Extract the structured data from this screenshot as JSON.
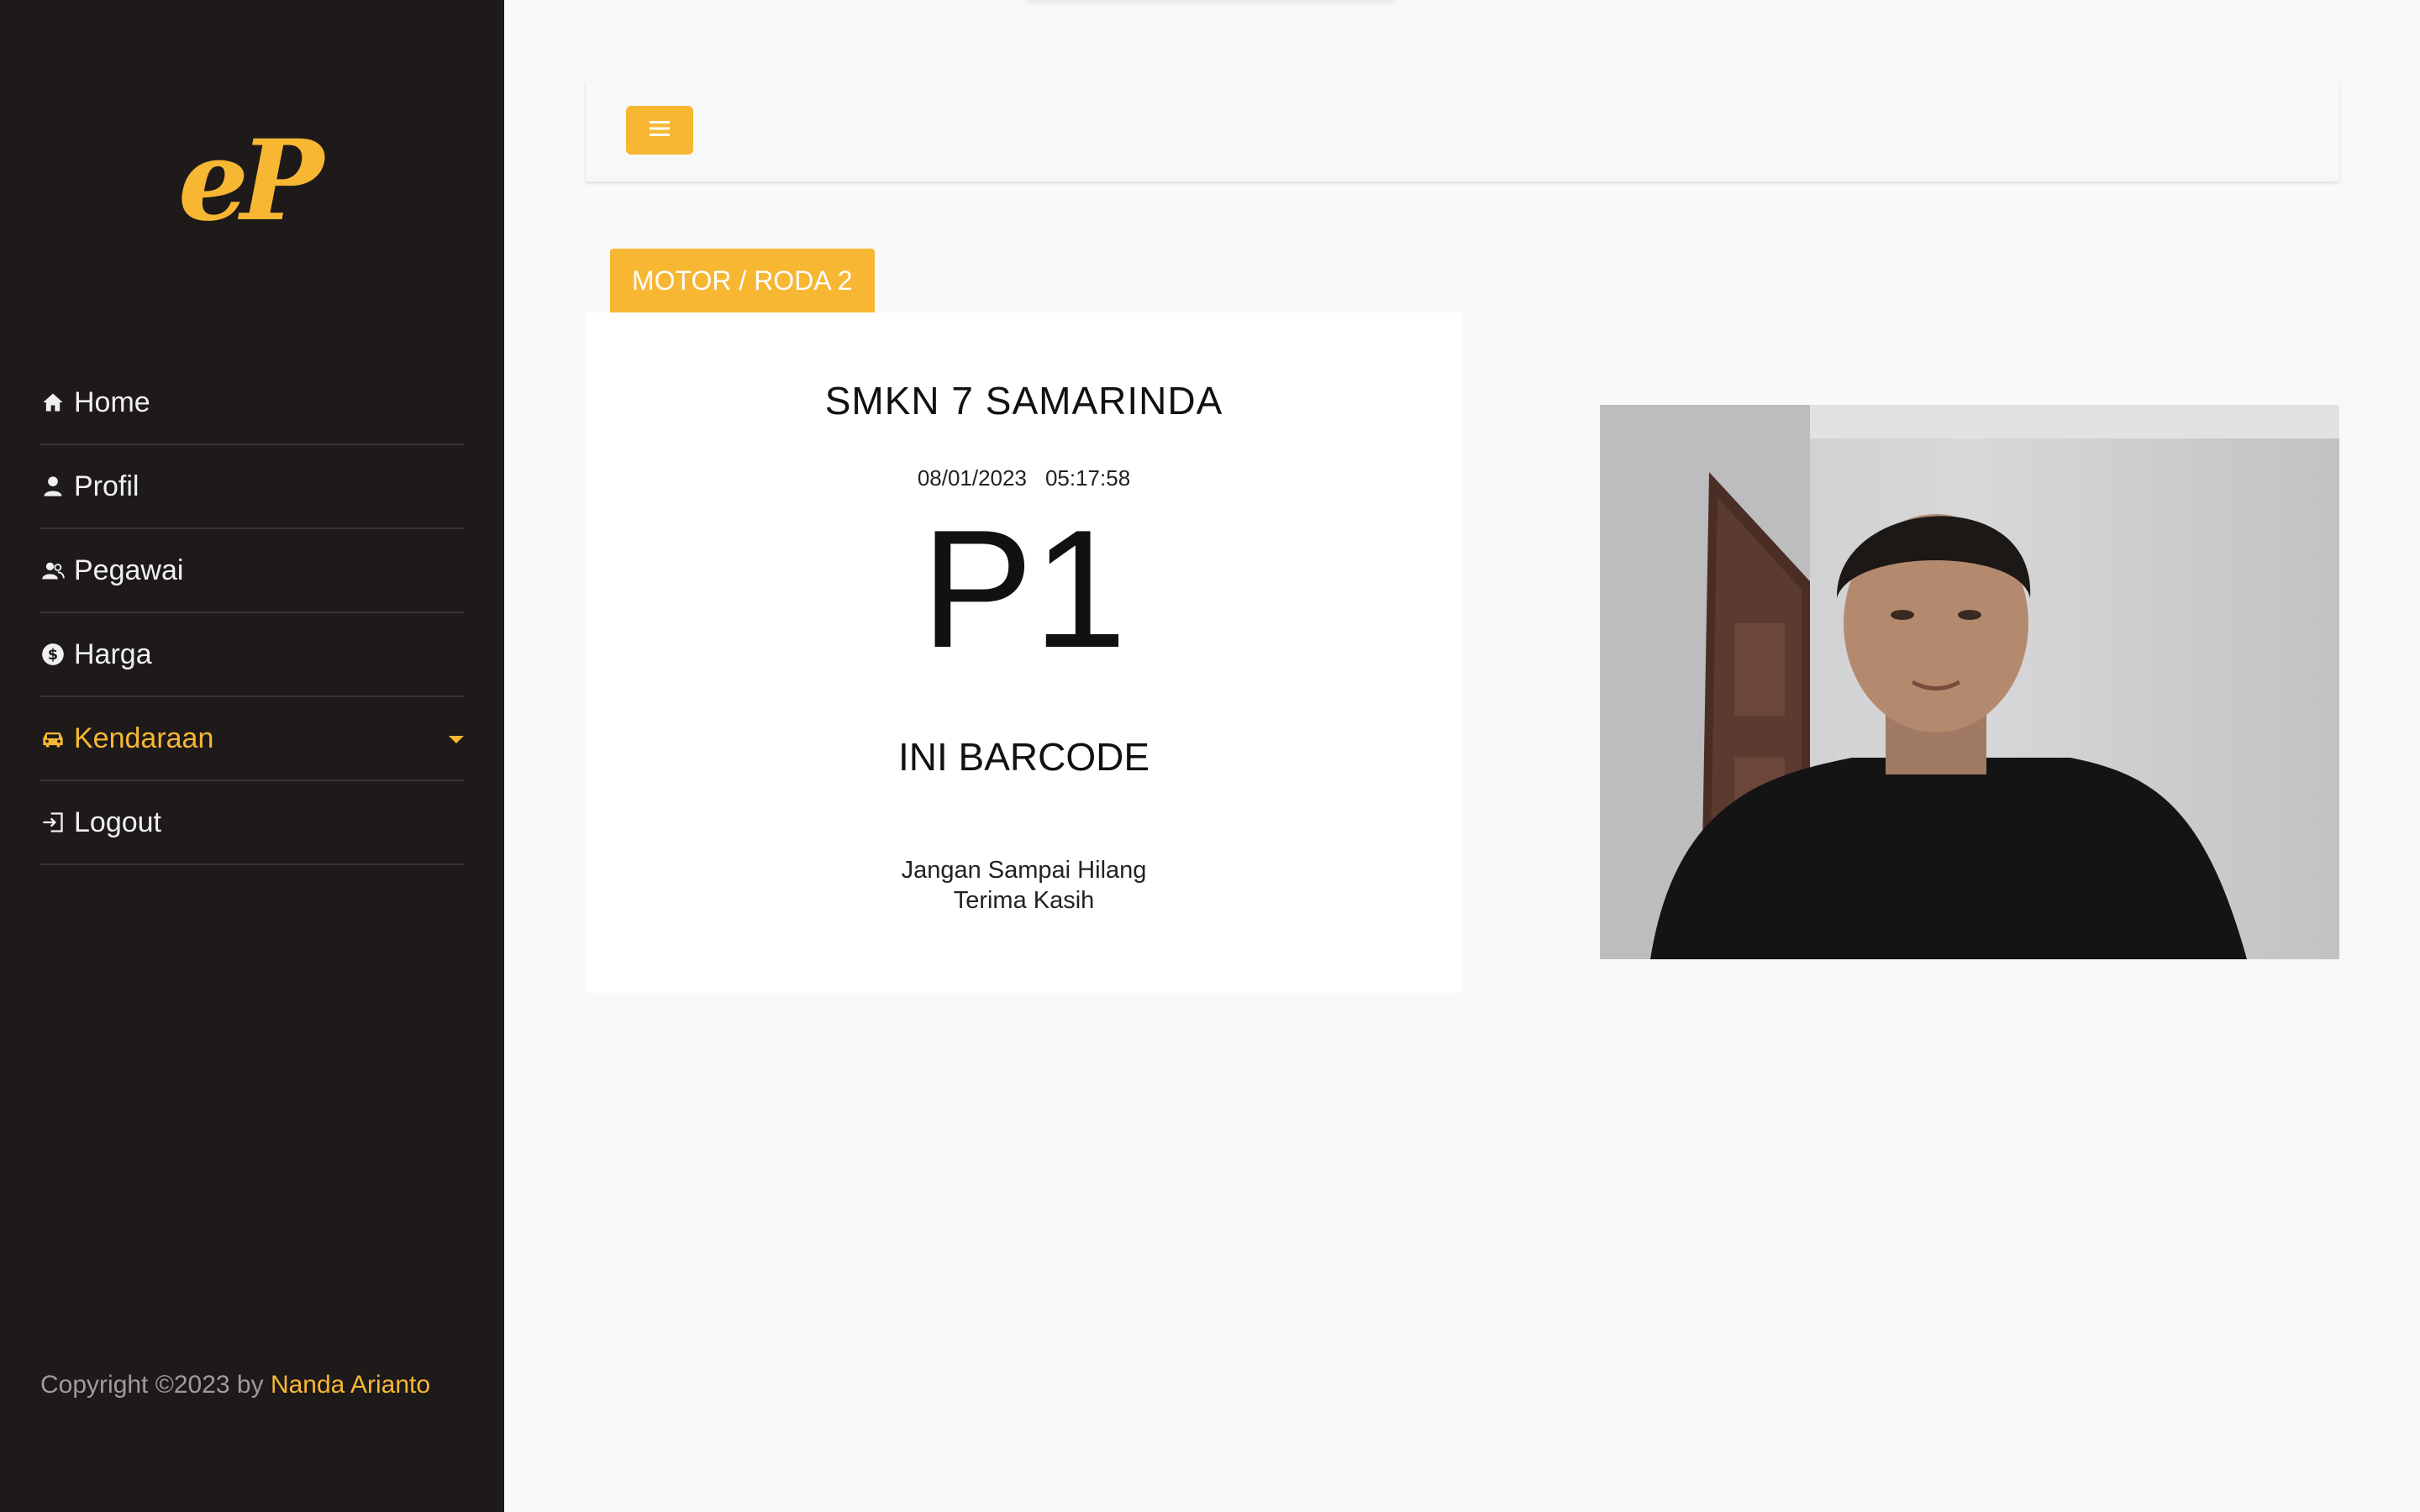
{
  "brand": {
    "logo_text": "eP"
  },
  "sidebar": {
    "items": [
      {
        "label": "Home",
        "icon": "home-icon"
      },
      {
        "label": "Profil",
        "icon": "user-icon"
      },
      {
        "label": "Pegawai",
        "icon": "users-icon"
      },
      {
        "label": "Harga",
        "icon": "dollar-icon"
      },
      {
        "label": "Kendaraan",
        "icon": "car-icon",
        "active": true,
        "has_dropdown": true
      },
      {
        "label": "Logout",
        "icon": "logout-icon"
      }
    ]
  },
  "footer": {
    "prefix": "Copyright ©2023 by",
    "author": "Nanda Arianto"
  },
  "topbar": {
    "toggle_icon": "hamburger-icon"
  },
  "main": {
    "vehicle_tag": "MOTOR / RODA 2",
    "ticket": {
      "school": "SMKN 7 SAMARINDA",
      "date": "08/01/2023",
      "time": "05:17:58",
      "code": "P1",
      "barcode": "INI BARCODE",
      "note_line1": "Jangan Sampai Hilang",
      "note_line2": "Terima Kasih"
    },
    "camera": {
      "icon": "camera-feed"
    }
  },
  "colors": {
    "accent": "#f7b733",
    "sidebar_bg": "#1e1a1a",
    "page_bg": "#f9f9f9"
  }
}
